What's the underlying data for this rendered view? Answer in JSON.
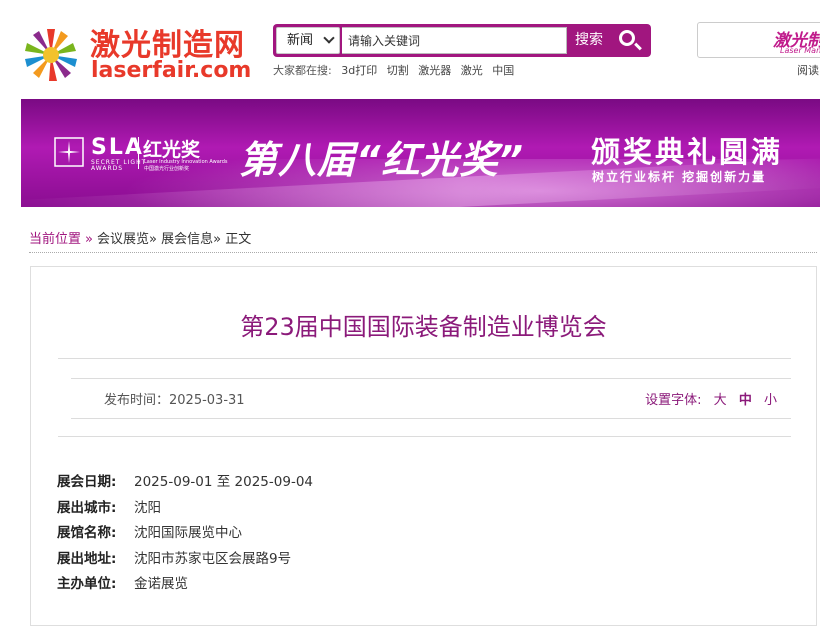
{
  "brand": {
    "name_cn": "激光制造网",
    "name_en": "laserfair.com",
    "accent": "#a1167f",
    "logo_red": "#e8392a"
  },
  "search": {
    "category": "新闻",
    "placeholder": "请输入关键词",
    "button_label": "搜索"
  },
  "hotwords": {
    "prefix": "大家都在搜:",
    "items": [
      "3d打印",
      "切割",
      "激光器",
      "激光",
      "中国"
    ]
  },
  "ad": {
    "title": "激光制",
    "subtitle": "Laser Man",
    "caption": "阅读"
  },
  "banner": {
    "sla": "SLA",
    "sla_sub1": "SECRET LIGHT",
    "sla_sub2": "AWARDS",
    "award": "红光奖",
    "award_sub1": "Laser Industry Innovation Awards",
    "award_sub2": "中国激光行业创新奖",
    "headline": "第八届“红光奖”",
    "headline2": "颁奖典礼圆满",
    "slogan": "树立行业标杆 挖掘创新力量"
  },
  "breadcrumb": {
    "home": "当前位置",
    "sep": "»",
    "items": [
      "会议展览",
      "展会信息",
      "正文"
    ],
    "item_sep": "»"
  },
  "article": {
    "title": "第23届中国国际装备制造业博览会",
    "pubdate_label": "发布时间：",
    "pubdate": "2025-03-31",
    "fontsize_label": "设置字体:",
    "fontsize_options": [
      "大",
      "中",
      "小"
    ],
    "fontsize_active": "中",
    "title_color": "#8b1a7a"
  },
  "info": [
    {
      "key": "展会日期:",
      "value": "2025-09-01 至 2025-09-04"
    },
    {
      "key": "展出城市:",
      "value": "沈阳"
    },
    {
      "key": "展馆名称:",
      "value": "沈阳国际展览中心"
    },
    {
      "key": "展出地址:",
      "value": "沈阳市苏家屯区会展路9号"
    },
    {
      "key": "主办单位:",
      "value": "金诺展览"
    }
  ]
}
